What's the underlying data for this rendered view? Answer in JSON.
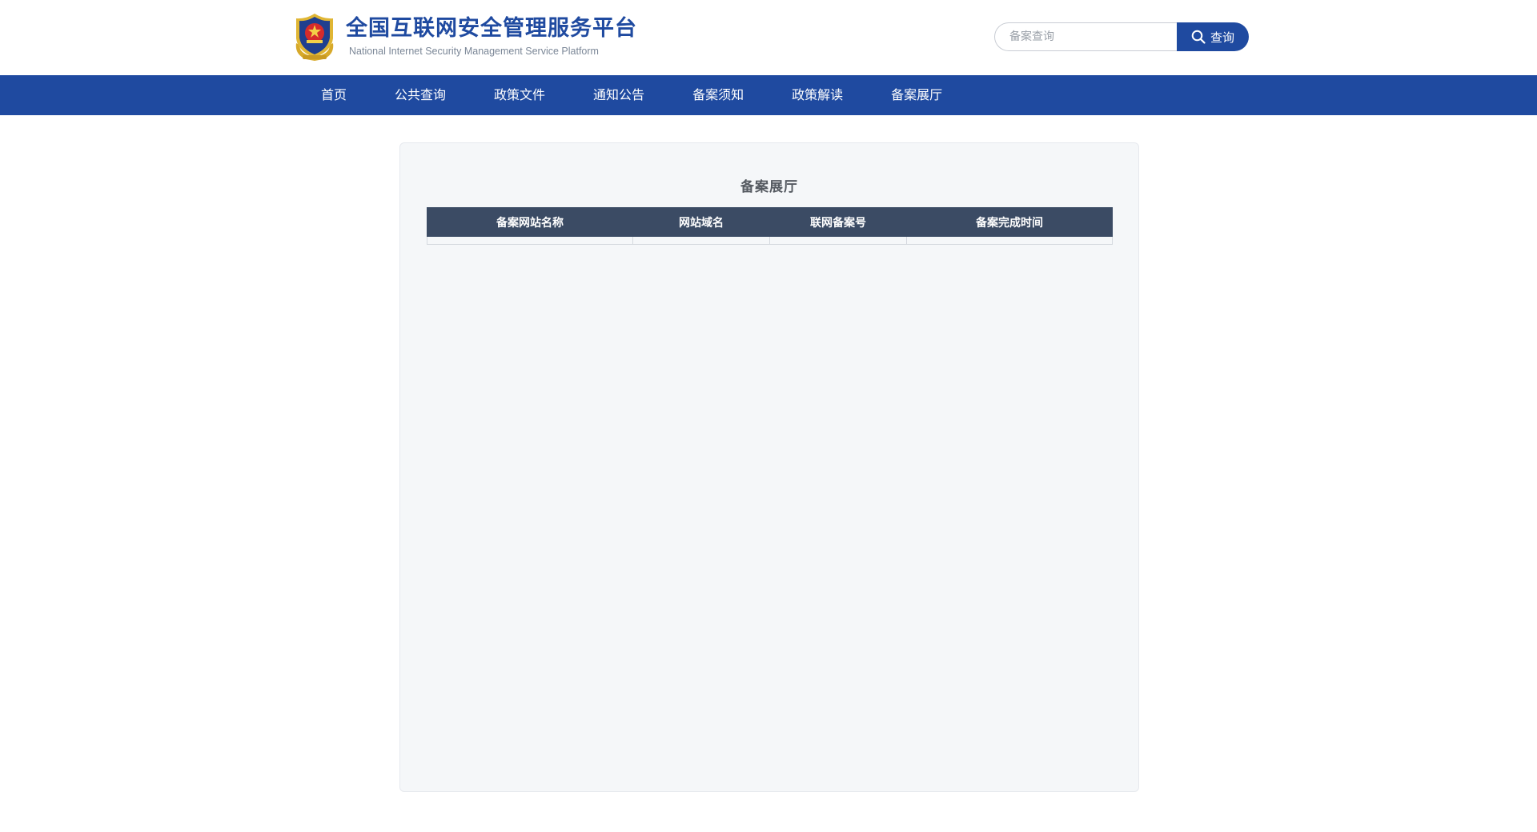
{
  "header": {
    "title": "全国互联网安全管理服务平台",
    "subtitle": "National Internet Security Management Service Platform",
    "emblem_icon": "police-emblem-icon",
    "search": {
      "placeholder": "备案查询",
      "value": "",
      "button_label": "查询",
      "button_icon": "search-icon"
    }
  },
  "nav": {
    "items": [
      {
        "label": "首页"
      },
      {
        "label": "公共查询"
      },
      {
        "label": "政策文件"
      },
      {
        "label": "通知公告"
      },
      {
        "label": "备案须知"
      },
      {
        "label": "政策解读"
      },
      {
        "label": "备案展厅"
      }
    ]
  },
  "main": {
    "title": "备案展厅",
    "table": {
      "columns": [
        "备案网站名称",
        "网站域名",
        "联网备案号",
        "备案完成时间"
      ],
      "rows": [
        [
          "",
          "",
          "",
          ""
        ]
      ]
    }
  },
  "colors": {
    "brand": "#1f4aa0",
    "table_header": "#3b4b64",
    "panel_bg": "#f5f7f9"
  }
}
